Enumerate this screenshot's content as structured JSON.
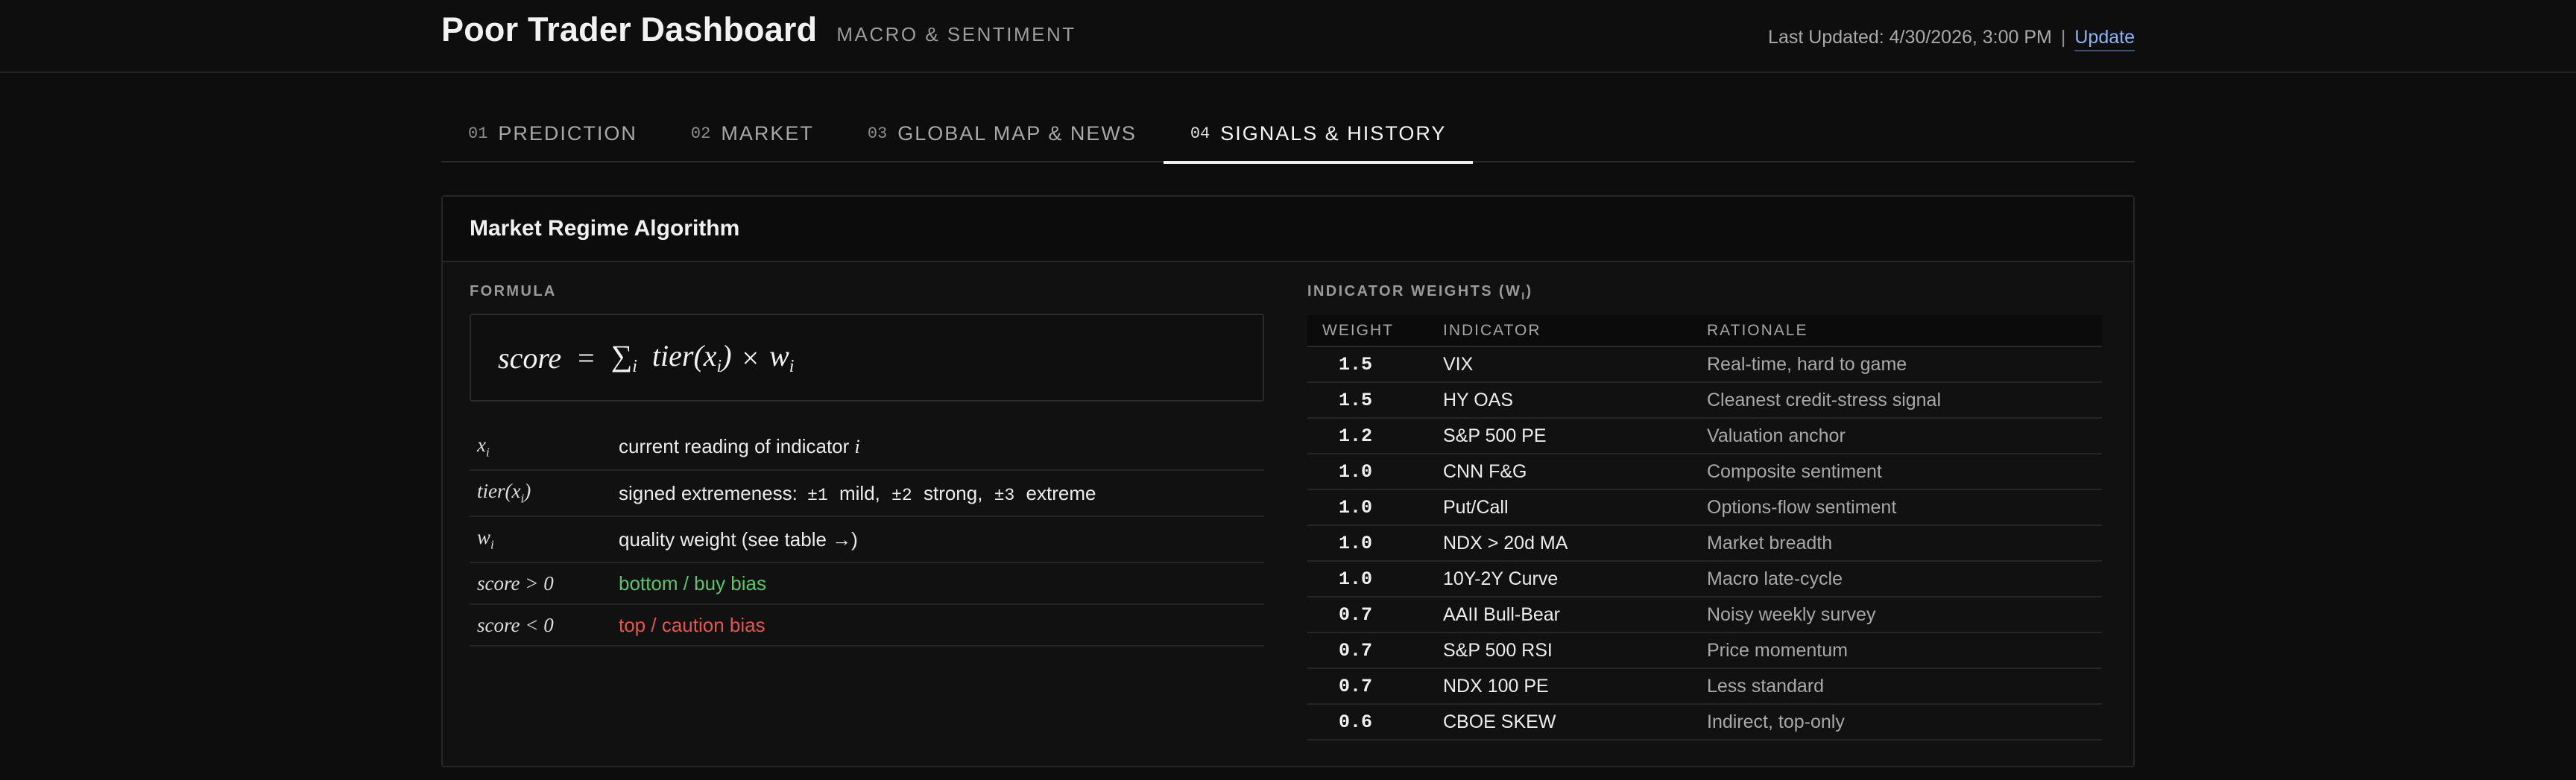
{
  "header": {
    "title": "Poor Trader Dashboard",
    "subtitle": "MACRO & SENTIMENT",
    "last_updated": "Last Updated: 4/30/2026, 3:00 PM",
    "separator": "|",
    "update_link": "Update"
  },
  "tabs": [
    {
      "num": "01",
      "label": "PREDICTION"
    },
    {
      "num": "02",
      "label": "MARKET"
    },
    {
      "num": "03",
      "label": "GLOBAL MAP & NEWS"
    },
    {
      "num": "04",
      "label": "SIGNALS & HISTORY"
    }
  ],
  "active_tab": "04",
  "panel": {
    "title": "Market Regime Algorithm",
    "formula_label": "FORMULA",
    "formula": {
      "lhs": "score",
      "eq": "=",
      "sum": "∑",
      "sum_sub": "i",
      "tier": "tier(x",
      "tier_sub": "i",
      "close": ")",
      "times": "×",
      "w": "w",
      "w_sub": "i"
    },
    "definitions": [
      {
        "sym": "x",
        "sub": "i",
        "tail": "",
        "text": "current reading of indicator ",
        "text_em": "i"
      },
      {
        "sym": "tier(x",
        "sub": "i",
        "tail": ")",
        "text": "signed extremeness: ",
        "text_em": ""
      },
      {
        "sym": "w",
        "sub": "i",
        "tail": "",
        "text": "quality weight (see table →)",
        "text_em": ""
      },
      {
        "sym": "score > 0",
        "sub": "",
        "tail": "",
        "text": "bottom / buy bias",
        "text_em": ""
      },
      {
        "sym": "score < 0",
        "sub": "",
        "tail": "",
        "text": "top / caution bias",
        "text_em": ""
      }
    ],
    "tier_levels": [
      {
        "val": "±1",
        "word": "mild,"
      },
      {
        "val": "±2",
        "word": "strong,"
      },
      {
        "val": "±3",
        "word": "extreme"
      }
    ],
    "weights_label": "INDICATOR WEIGHTS (W",
    "weights_label_sub": "I",
    "weights_label_close": ")",
    "weights_columns": [
      "WEIGHT",
      "INDICATOR",
      "RATIONALE"
    ],
    "weights": [
      {
        "weight": "1.5",
        "indicator": "VIX",
        "rationale": "Real-time, hard to game"
      },
      {
        "weight": "1.5",
        "indicator": "HY OAS",
        "rationale": "Cleanest credit-stress signal"
      },
      {
        "weight": "1.2",
        "indicator": "S&P 500 PE",
        "rationale": "Valuation anchor"
      },
      {
        "weight": "1.0",
        "indicator": "CNN F&G",
        "rationale": "Composite sentiment"
      },
      {
        "weight": "1.0",
        "indicator": "Put/Call",
        "rationale": "Options-flow sentiment"
      },
      {
        "weight": "1.0",
        "indicator": "NDX > 20d MA",
        "rationale": "Market breadth"
      },
      {
        "weight": "1.0",
        "indicator": "10Y-2Y Curve",
        "rationale": "Macro late-cycle"
      },
      {
        "weight": "0.7",
        "indicator": "AAII Bull-Bear",
        "rationale": "Noisy weekly survey"
      },
      {
        "weight": "0.7",
        "indicator": "S&P 500 RSI",
        "rationale": "Price momentum"
      },
      {
        "weight": "0.7",
        "indicator": "NDX 100 PE",
        "rationale": "Less standard"
      },
      {
        "weight": "0.6",
        "indicator": "CBOE SKEW",
        "rationale": "Indirect, top-only"
      }
    ]
  },
  "colors": {
    "positive": "#5cc46b",
    "negative": "#e4554d",
    "link": "#8ab4f8"
  }
}
